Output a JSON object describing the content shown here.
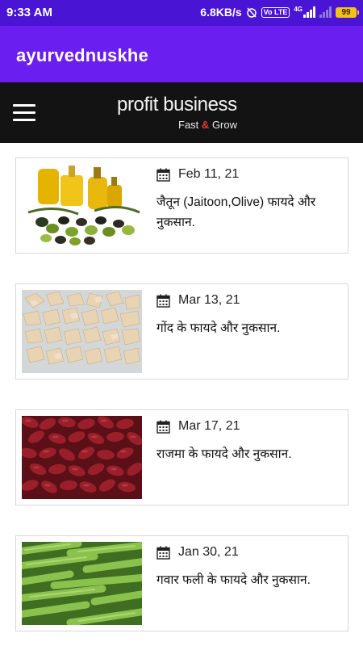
{
  "status_bar": {
    "time": "9:33 AM",
    "net_speed": "6.8KB/s",
    "volte_badge": "Vo LTE",
    "network_badge": "4G",
    "battery": "99"
  },
  "app_bar": {
    "title": "ayurvednuskhe"
  },
  "brand": {
    "name": "profit business",
    "tag_left": "Fast",
    "tag_amp": "&",
    "tag_right": "Grow"
  },
  "posts": [
    {
      "date": "Feb 11, 21",
      "title": "जैतून (Jaitoon,Olive) फायदे और नुकसान.",
      "image": "olive-oil-image"
    },
    {
      "date": "Mar 13, 21",
      "title": "गोंद के फायदे और नुकसान.",
      "image": "gond-image"
    },
    {
      "date": "Mar 17, 21",
      "title": "राजमा के फायदे और नुकसान.",
      "image": "rajma-image"
    },
    {
      "date": "Jan 30, 21",
      "title": "गवार फली के फायदे और नुकसान.",
      "image": "guar-beans-image"
    }
  ],
  "icons": {
    "menu": "hamburger-icon",
    "date": "calendar-icon"
  },
  "colors": {
    "status_bar": "#4a14d4",
    "app_bar": "#6a1ff0",
    "brand_bar": "#131313",
    "accent": "#e53935"
  }
}
